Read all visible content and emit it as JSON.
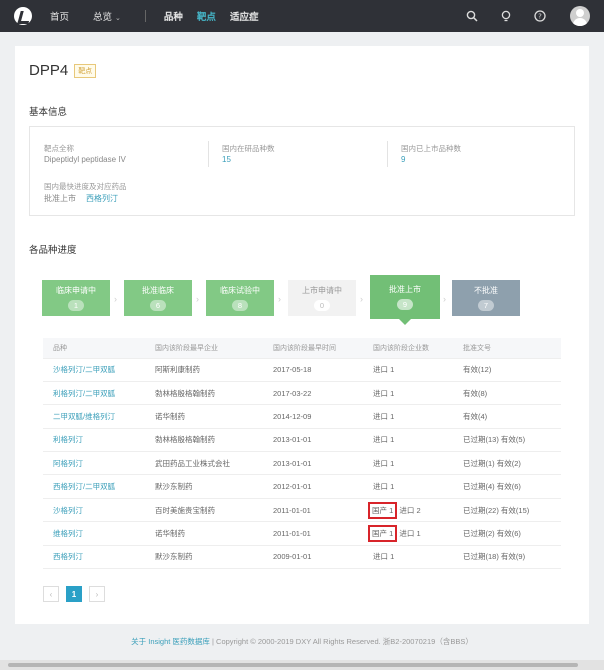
{
  "nav": {
    "items": [
      "首页",
      "总览"
    ],
    "sub_items": [
      "品种",
      "靶点",
      "适应症"
    ],
    "active_sub": "靶点"
  },
  "page": {
    "title": "DPP4",
    "tag": "靶点"
  },
  "basic": {
    "section_title": "基本信息",
    "full_name_label": "靶点全称",
    "full_name_value": "Dipeptidyl peptidase IV",
    "in_research_label": "国内在研品种数",
    "in_research_value": "15",
    "marketed_label": "国内已上市品种数",
    "marketed_value": "9",
    "fastest_label": "国内最快进度及对应药品",
    "fastest_stage": "批准上市",
    "fastest_drug": "西格列汀"
  },
  "progress": {
    "section_title": "各品种进度",
    "stages": [
      {
        "label": "临床申请中",
        "count": "1"
      },
      {
        "label": "批准临床",
        "count": "6"
      },
      {
        "label": "临床试验中",
        "count": "8"
      },
      {
        "label": "上市申请中",
        "count": "0"
      },
      {
        "label": "批准上市",
        "count": "9"
      },
      {
        "label": "不批准",
        "count": "7"
      }
    ]
  },
  "table": {
    "headers": [
      "品种",
      "国内该阶段最早企业",
      "国内该阶段最早时间",
      "国内该阶段企业数",
      "批准文号"
    ],
    "rows": [
      {
        "name": "沙格列汀/二甲双胍",
        "company": "阿斯利康制药",
        "date": "2017-05-18",
        "count": "进口 1",
        "approval": "有效(12)"
      },
      {
        "name": "利格列汀/二甲双胍",
        "company": "勃林格殷格翰制药",
        "date": "2017-03-22",
        "count": "进口 1",
        "approval": "有效(8)"
      },
      {
        "name": "二甲双胍/维格列汀",
        "company": "诺华制药",
        "date": "2014-12-09",
        "count": "进口 1",
        "approval": "有效(4)"
      },
      {
        "name": "利格列汀",
        "company": "勃林格殷格翰制药",
        "date": "2013-01-01",
        "count": "进口 1",
        "approval": "已过期(13) 有效(5)"
      },
      {
        "name": "阿格列汀",
        "company": "武田药品工业株式会社",
        "date": "2013-01-01",
        "count": "进口 1",
        "approval": "已过期(1) 有效(2)"
      },
      {
        "name": "西格列汀/二甲双胍",
        "company": "默沙东制药",
        "date": "2012-01-01",
        "count": "进口 1",
        "approval": "已过期(4) 有效(6)"
      },
      {
        "name": "沙格列汀",
        "company": "百时美施贵宝制药",
        "date": "2011-01-01",
        "count_domestic": "国产 1",
        "count": "进口 2",
        "approval": "已过期(22) 有效(15)"
      },
      {
        "name": "维格列汀",
        "company": "诺华制药",
        "date": "2011-01-01",
        "count_domestic": "国产 1",
        "count": "进口 1",
        "approval": "已过期(2) 有效(6)"
      },
      {
        "name": "西格列汀",
        "company": "默沙东制药",
        "date": "2009-01-01",
        "count": "进口 1",
        "approval": "已过期(18) 有效(9)"
      }
    ]
  },
  "pagination": {
    "prev": "‹",
    "current": "1",
    "next": "›"
  },
  "footer": {
    "link": "关于 Insight 医药数据库",
    "text": " | Copyright © 2000-2019 DXY All Rights Reserved. 浙B2-20070219（含BBS）"
  },
  "colors": {
    "accent": "#46b7c9",
    "link": "#3b9fba",
    "stage_green": "#82c985",
    "stage_slate": "#8ea0ad",
    "highlight_red": "#d8242a"
  }
}
